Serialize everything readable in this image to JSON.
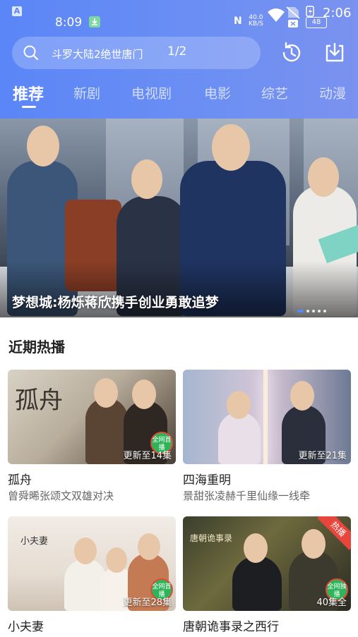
{
  "status_bar": {
    "time": "8:09",
    "network_speed_value": "40.0",
    "network_speed_unit": "KB/S",
    "battery_percent": "48",
    "clock": "2:06",
    "nfc_label": "N"
  },
  "search": {
    "query": "斗罗大陆2绝世唐门",
    "page_indicator": "1/2"
  },
  "tabs": [
    {
      "label": "推荐",
      "active": true
    },
    {
      "label": "新剧",
      "active": false
    },
    {
      "label": "电视剧",
      "active": false
    },
    {
      "label": "电影",
      "active": false
    },
    {
      "label": "综艺",
      "active": false
    },
    {
      "label": "动漫",
      "active": false
    }
  ],
  "banner": {
    "caption": "梦想城:杨烁蒋欣携手创业勇敢追梦",
    "dots_total": 5,
    "dots_active": 1
  },
  "recent": {
    "title": "近期热播",
    "items": [
      {
        "title": "孤舟",
        "subtitle": "曾舜晞张颂文双雄对决",
        "episodes": "更新至14集",
        "poster_text": "孤舟",
        "badge": "全网首播"
      },
      {
        "title": "四海重明",
        "subtitle": "景甜张凌赫千里仙缘一线牵",
        "episodes": "更新至21集"
      },
      {
        "title": "小夫妻",
        "subtitle": "",
        "episodes": "更新至28集",
        "poster_text": "小夫妻",
        "badge": "全网首播"
      },
      {
        "title": "唐朝诡事录之西行",
        "subtitle": "",
        "episodes": "40集全",
        "poster_text": "唐朝诡事录",
        "badge": "全网独播",
        "ribbon": "热播"
      }
    ]
  },
  "colors": {
    "header_gradient_start": "#5b86f7",
    "header_gradient_end": "#7b92ef",
    "accent": "#4f8cff",
    "hot_ribbon": "#e8453c",
    "badge_green": "#2fb45a"
  }
}
